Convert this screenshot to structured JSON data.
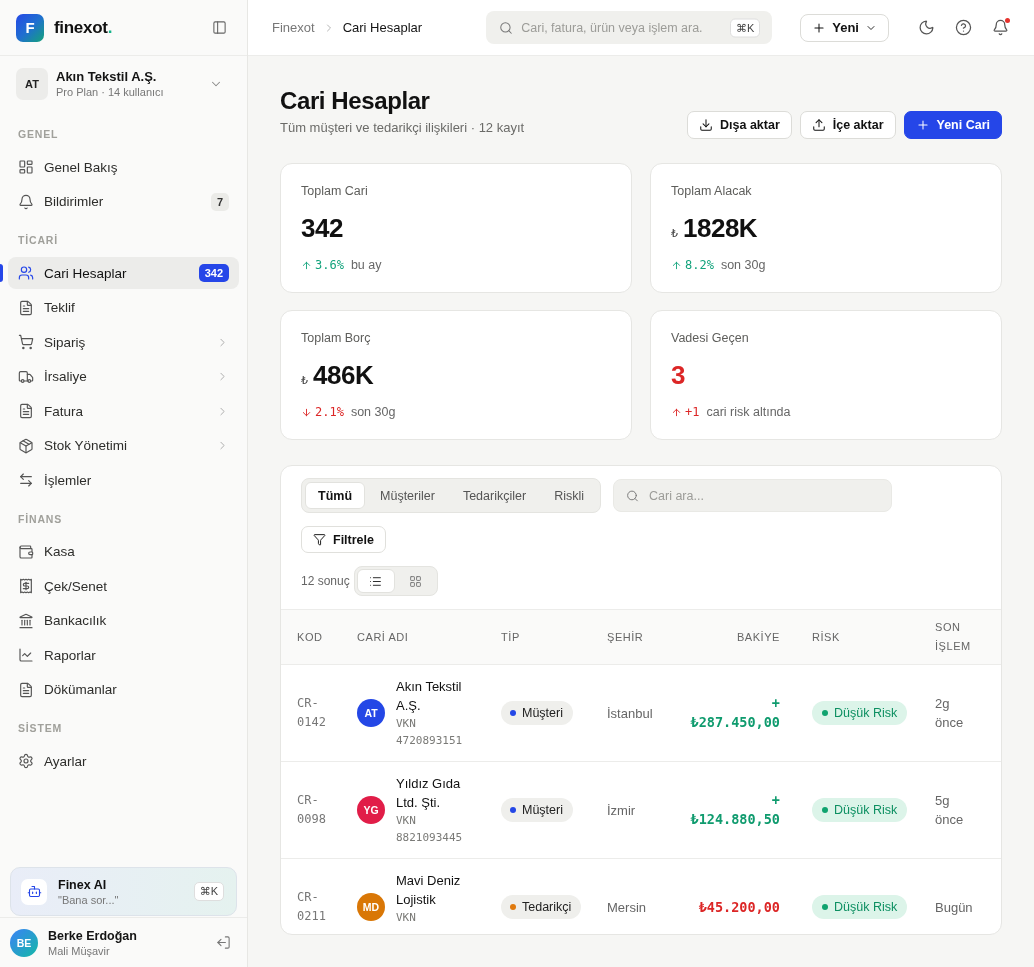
{
  "sidebar": {
    "logo": {
      "mark": "F",
      "name": "finexot",
      "accent": "."
    },
    "company": {
      "initials": "AT",
      "name": "Akın Tekstil A.Ş.",
      "plan": "Pro Plan · 14 kullanıcı"
    },
    "sections": [
      {
        "label": "GENEL",
        "items": [
          {
            "label": "Genel Bakış",
            "selected": false,
            "has_submenu": false
          },
          {
            "label": "Bildirimler",
            "badge": "7",
            "selected": false,
            "has_submenu": false
          }
        ]
      },
      {
        "label": "TİCARİ",
        "items": [
          {
            "label": "Cari Hesaplar",
            "badge": "342",
            "selected": true,
            "has_submenu": false
          },
          {
            "label": "Teklif",
            "selected": false,
            "has_submenu": false
          },
          {
            "label": "Sipariş",
            "selected": false,
            "has_submenu": true
          },
          {
            "label": "İrsaliye",
            "selected": false,
            "has_submenu": true
          },
          {
            "label": "Fatura",
            "selected": false,
            "has_submenu": true
          },
          {
            "label": "Stok Yönetimi",
            "selected": false,
            "has_submenu": true
          },
          {
            "label": "İşlemler",
            "selected": false,
            "has_submenu": false
          }
        ]
      },
      {
        "label": "FİNANS",
        "items": [
          {
            "label": "Kasa",
            "selected": false,
            "has_submenu": false
          },
          {
            "label": "Çek/Senet",
            "selected": false,
            "has_submenu": false
          },
          {
            "label": "Bankacılık",
            "selected": false,
            "has_submenu": false
          },
          {
            "label": "Raporlar",
            "selected": false,
            "has_submenu": false
          },
          {
            "label": "Dökümanlar",
            "selected": false,
            "has_submenu": false
          }
        ]
      },
      {
        "label": "SİSTEM",
        "items": [
          {
            "label": "Ayarlar",
            "selected": false,
            "has_submenu": false
          }
        ]
      }
    ],
    "assistant": {
      "title": "Finex AI",
      "subtitle": "\"Bana sor...\"",
      "shortcut": "⌘K"
    },
    "user": {
      "initials": "BE",
      "name": "Berke Erdoğan",
      "role": "Mali Müşavir"
    }
  },
  "header": {
    "breadcrumb": [
      "Finexot",
      "Cari Hesaplar"
    ],
    "search": {
      "placeholder": "Cari, fatura, ürün veya işlem ara.",
      "shortcut": "⌘K"
    },
    "new_button": "Yeni",
    "notifications_unread": true
  },
  "page": {
    "title": "Cari Hesaplar",
    "subtitle": "Tüm müşteri ve tedarikçi ilişkileri · 12 kayıt",
    "actions": [
      {
        "label": "Dışa aktar",
        "kind": "export"
      },
      {
        "label": "İçe aktar",
        "kind": "import"
      },
      {
        "label": "Yeni Cari",
        "kind": "create"
      }
    ]
  },
  "stats": [
    {
      "label": "Toplam Cari",
      "value": "342",
      "rising": true,
      "favorable": true,
      "change": "3.6%",
      "note": "bu ay",
      "alert": false
    },
    {
      "label": "Toplam Alacak",
      "currency": "₺",
      "value": "1828K",
      "rising": true,
      "favorable": true,
      "change": "8.2%",
      "note": "son 30g",
      "alert": false
    },
    {
      "label": "Toplam Borç",
      "currency": "₺",
      "value": "486K",
      "rising": false,
      "favorable": false,
      "change": "2.1%",
      "note": "son 30g",
      "alert": false
    },
    {
      "label": "Vadesi Geçen",
      "value": "3",
      "rising": true,
      "favorable": false,
      "change": "+1",
      "note": "cari risk altında",
      "alert": true
    }
  ],
  "table": {
    "tabs": [
      {
        "label": "Tümü",
        "selected": true
      },
      {
        "label": "Müşteriler",
        "selected": false
      },
      {
        "label": "Tedarikçiler",
        "selected": false
      },
      {
        "label": "Riskli",
        "selected": false
      }
    ],
    "search": {
      "placeholder": "Cari ara..."
    },
    "filter_button": "Filtrele",
    "result_count": "12 sonuç",
    "view_modes": [
      {
        "selected": true
      },
      {
        "selected": false
      }
    ],
    "columns": [
      "KOD",
      "CARİ ADI",
      "TİP",
      "ŞEHİR",
      "BAKİYE",
      "RİSK",
      "SON İŞLEM"
    ],
    "rows": [
      {
        "code": "CR-0142",
        "avatar": {
          "initials": "AT",
          "color": "#2447e6"
        },
        "name": "Akın Tekstil A.Ş.",
        "tax_id": "VKN 4720893151",
        "type": {
          "label": "Müşteri",
          "color": "#2447e6"
        },
        "city": "İstanbul",
        "balance": {
          "text": "+ ₺287.450,00",
          "kind": "credit"
        },
        "risk": {
          "label": "Düşük Risk",
          "kind": "low"
        },
        "last_activity": "2g önce"
      },
      {
        "code": "CR-0098",
        "avatar": {
          "initials": "YG",
          "color": "#e11d48"
        },
        "name": "Yıldız Gıda Ltd. Şti.",
        "tax_id": "VKN 8821093445",
        "type": {
          "label": "Müşteri",
          "color": "#2447e6"
        },
        "city": "İzmir",
        "balance": {
          "text": "+ ₺124.880,50",
          "kind": "credit"
        },
        "risk": {
          "label": "Düşük Risk",
          "kind": "low"
        },
        "last_activity": "5g önce"
      },
      {
        "code": "CR-0211",
        "avatar": {
          "initials": "MD",
          "color": "#d97706"
        },
        "name": "Mavi Deniz Lojistik",
        "tax_id": "VKN",
        "type": {
          "label": "Tedarikçi",
          "color": "#e07a0e"
        },
        "city": "Mersin",
        "balance": {
          "text": "₺45.200,00",
          "kind": "debit"
        },
        "risk": {
          "label": "Düşük Risk",
          "kind": "low"
        },
        "last_activity": "Bugün"
      }
    ]
  }
}
